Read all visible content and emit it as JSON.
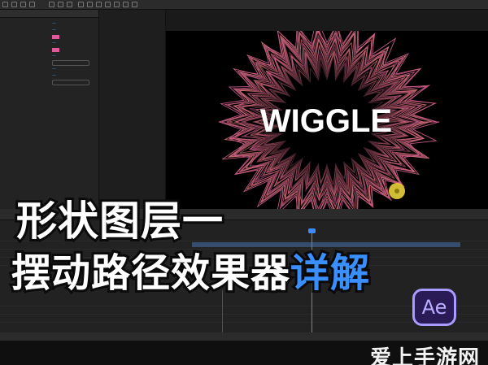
{
  "toolbar": {
    "tool_icons": [
      "home-icon",
      "select-icon",
      "hand-icon",
      "zoom-icon",
      "rotate-icon",
      "camera-icon",
      "pan-icon",
      "rect-icon",
      "pen-icon",
      "text-icon",
      "brush-icon",
      "stamp-icon",
      "eraser-icon",
      "puppet-icon"
    ],
    "right_items": [
      "",
      "",
      ""
    ]
  },
  "effects_panel": {
    "tabs": [
      "",
      ""
    ],
    "rows": [
      "",
      "",
      "",
      "",
      "",
      "",
      "",
      "",
      "",
      ""
    ]
  },
  "composition": {
    "tabs": [
      "",
      ""
    ]
  },
  "viewer": {
    "title_text": "WIGGLE",
    "ring_colors": [
      "#c85a8a",
      "#e07a7a",
      "#d06080"
    ],
    "cursor_color": "#e8d23a"
  },
  "banner": {
    "line1": "形状图层一",
    "line2_main": "摆动路径效果器",
    "line2_accent": "详解"
  },
  "logo": {
    "text": "Ae"
  },
  "watermark": {
    "text": "爱上手游网"
  }
}
